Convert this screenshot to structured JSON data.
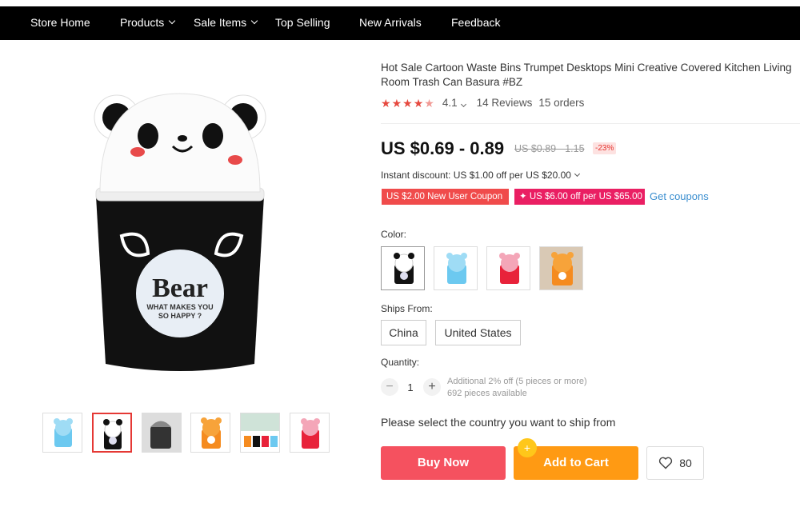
{
  "nav": {
    "items": [
      {
        "label": "Store Home"
      },
      {
        "label": "Products"
      },
      {
        "label": "Sale Items"
      },
      {
        "label": "Top Selling"
      },
      {
        "label": "New Arrivals"
      },
      {
        "label": "Feedback"
      }
    ]
  },
  "product": {
    "image_text_main": "Bear",
    "image_text_sub1": "WHAT MAKES YOU",
    "image_text_sub2": "SO HAPPY ?",
    "title": "Hot Sale Cartoon Waste Bins Trumpet Desktops Mini Creative Covered Kitchen Living Room Trash Can Basura #BZ",
    "rating": "4.1",
    "rating_stars": 4.1,
    "reviews": "14 Reviews",
    "orders": "15 orders",
    "price": "US $0.69 - 0.89",
    "old_price": "US $0.89 - 1.15",
    "discount": "-23%",
    "instant_discount": "Instant discount: US $1.00 off per US $20.00",
    "coupon_new_user": "US $2.00 New User Coupon",
    "coupon_store": "✦ US $6.00 off per US $65.00",
    "get_coupons": "Get coupons"
  },
  "thumbnails": [
    {
      "name": "thumb-blue-bear"
    },
    {
      "name": "thumb-panda",
      "active": true
    },
    {
      "name": "thumb-black-bin"
    },
    {
      "name": "thumb-orange-tiger"
    },
    {
      "name": "thumb-multi"
    },
    {
      "name": "thumb-pink-pig"
    }
  ],
  "options": {
    "color_label": "Color:",
    "colors": [
      {
        "name": "panda",
        "body": "#111111",
        "lid": "#ffffff"
      },
      {
        "name": "blue",
        "body": "#6cc9f0",
        "lid": "#9fdcf5"
      },
      {
        "name": "pink",
        "body": "#e8223a",
        "lid": "#f4a6b8"
      },
      {
        "name": "tiger",
        "body": "#f58b1f",
        "lid": "#f7a33a"
      }
    ],
    "ships_from_label": "Ships From:",
    "ships_from": [
      "China",
      "United States"
    ],
    "quantity_label": "Quantity:",
    "quantity_minus": "−",
    "quantity_plus": "+",
    "quantity": "1",
    "quantity_note_1": "Additional 2% off (5 pieces or more)",
    "quantity_note_2": "692 pieces available"
  },
  "shipping_note": "Please select the country you want to ship from",
  "actions": {
    "buy_now": "Buy Now",
    "add_to_cart": "Add to Cart",
    "cart_badge": "+",
    "wishlist_count": "80"
  },
  "colors": {
    "buy_now": "#f5515f",
    "add_to_cart": "#ff9a13",
    "coupon_red": "#f04b4b",
    "coupon_pink": "#ea1f63",
    "star": "#e6493f",
    "link": "#3a8ecf"
  }
}
